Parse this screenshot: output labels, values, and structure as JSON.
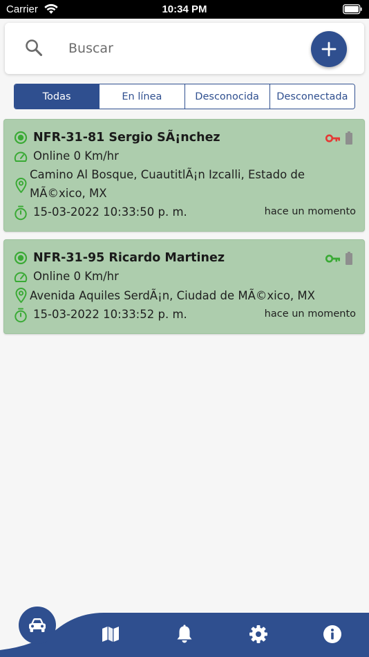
{
  "status_bar": {
    "carrier": "Carrier",
    "time": "10:34 PM"
  },
  "search": {
    "placeholder": "Buscar"
  },
  "tabs": [
    {
      "label": "Todas",
      "active": true
    },
    {
      "label": "En línea",
      "active": false
    },
    {
      "label": "Desconocida",
      "active": false
    },
    {
      "label": "Desconectada",
      "active": false
    }
  ],
  "vehicles": [
    {
      "name": "NFR-31-81 Sergio SÃ¡nchez",
      "status": "Online 0 Km/hr",
      "address": "Camino Al Bosque, CuautitlÃ¡n Izcalli, Estado de MÃ©xico, MX",
      "datetime": "15-03-2022 10:33:50 p. m.",
      "ago": "hace un momento",
      "key_color": "#e53935"
    },
    {
      "name": "NFR-31-95 Ricardo Martinez",
      "status": "Online 0 Km/hr",
      "address": "Avenida Aquiles SerdÃ¡n, Ciudad de MÃ©xico, MX",
      "datetime": "15-03-2022 10:33:52 p. m.",
      "ago": "hace un momento",
      "key_color": "#3aaa35"
    }
  ],
  "colors": {
    "primary": "#2f4f8f",
    "card_bg": "#adcdad",
    "online_green": "#3aaa35",
    "battery_gray": "#8e8e8e"
  },
  "bottom_nav": [
    "car-icon",
    "map-icon",
    "bell-icon",
    "gear-icon",
    "info-icon"
  ]
}
